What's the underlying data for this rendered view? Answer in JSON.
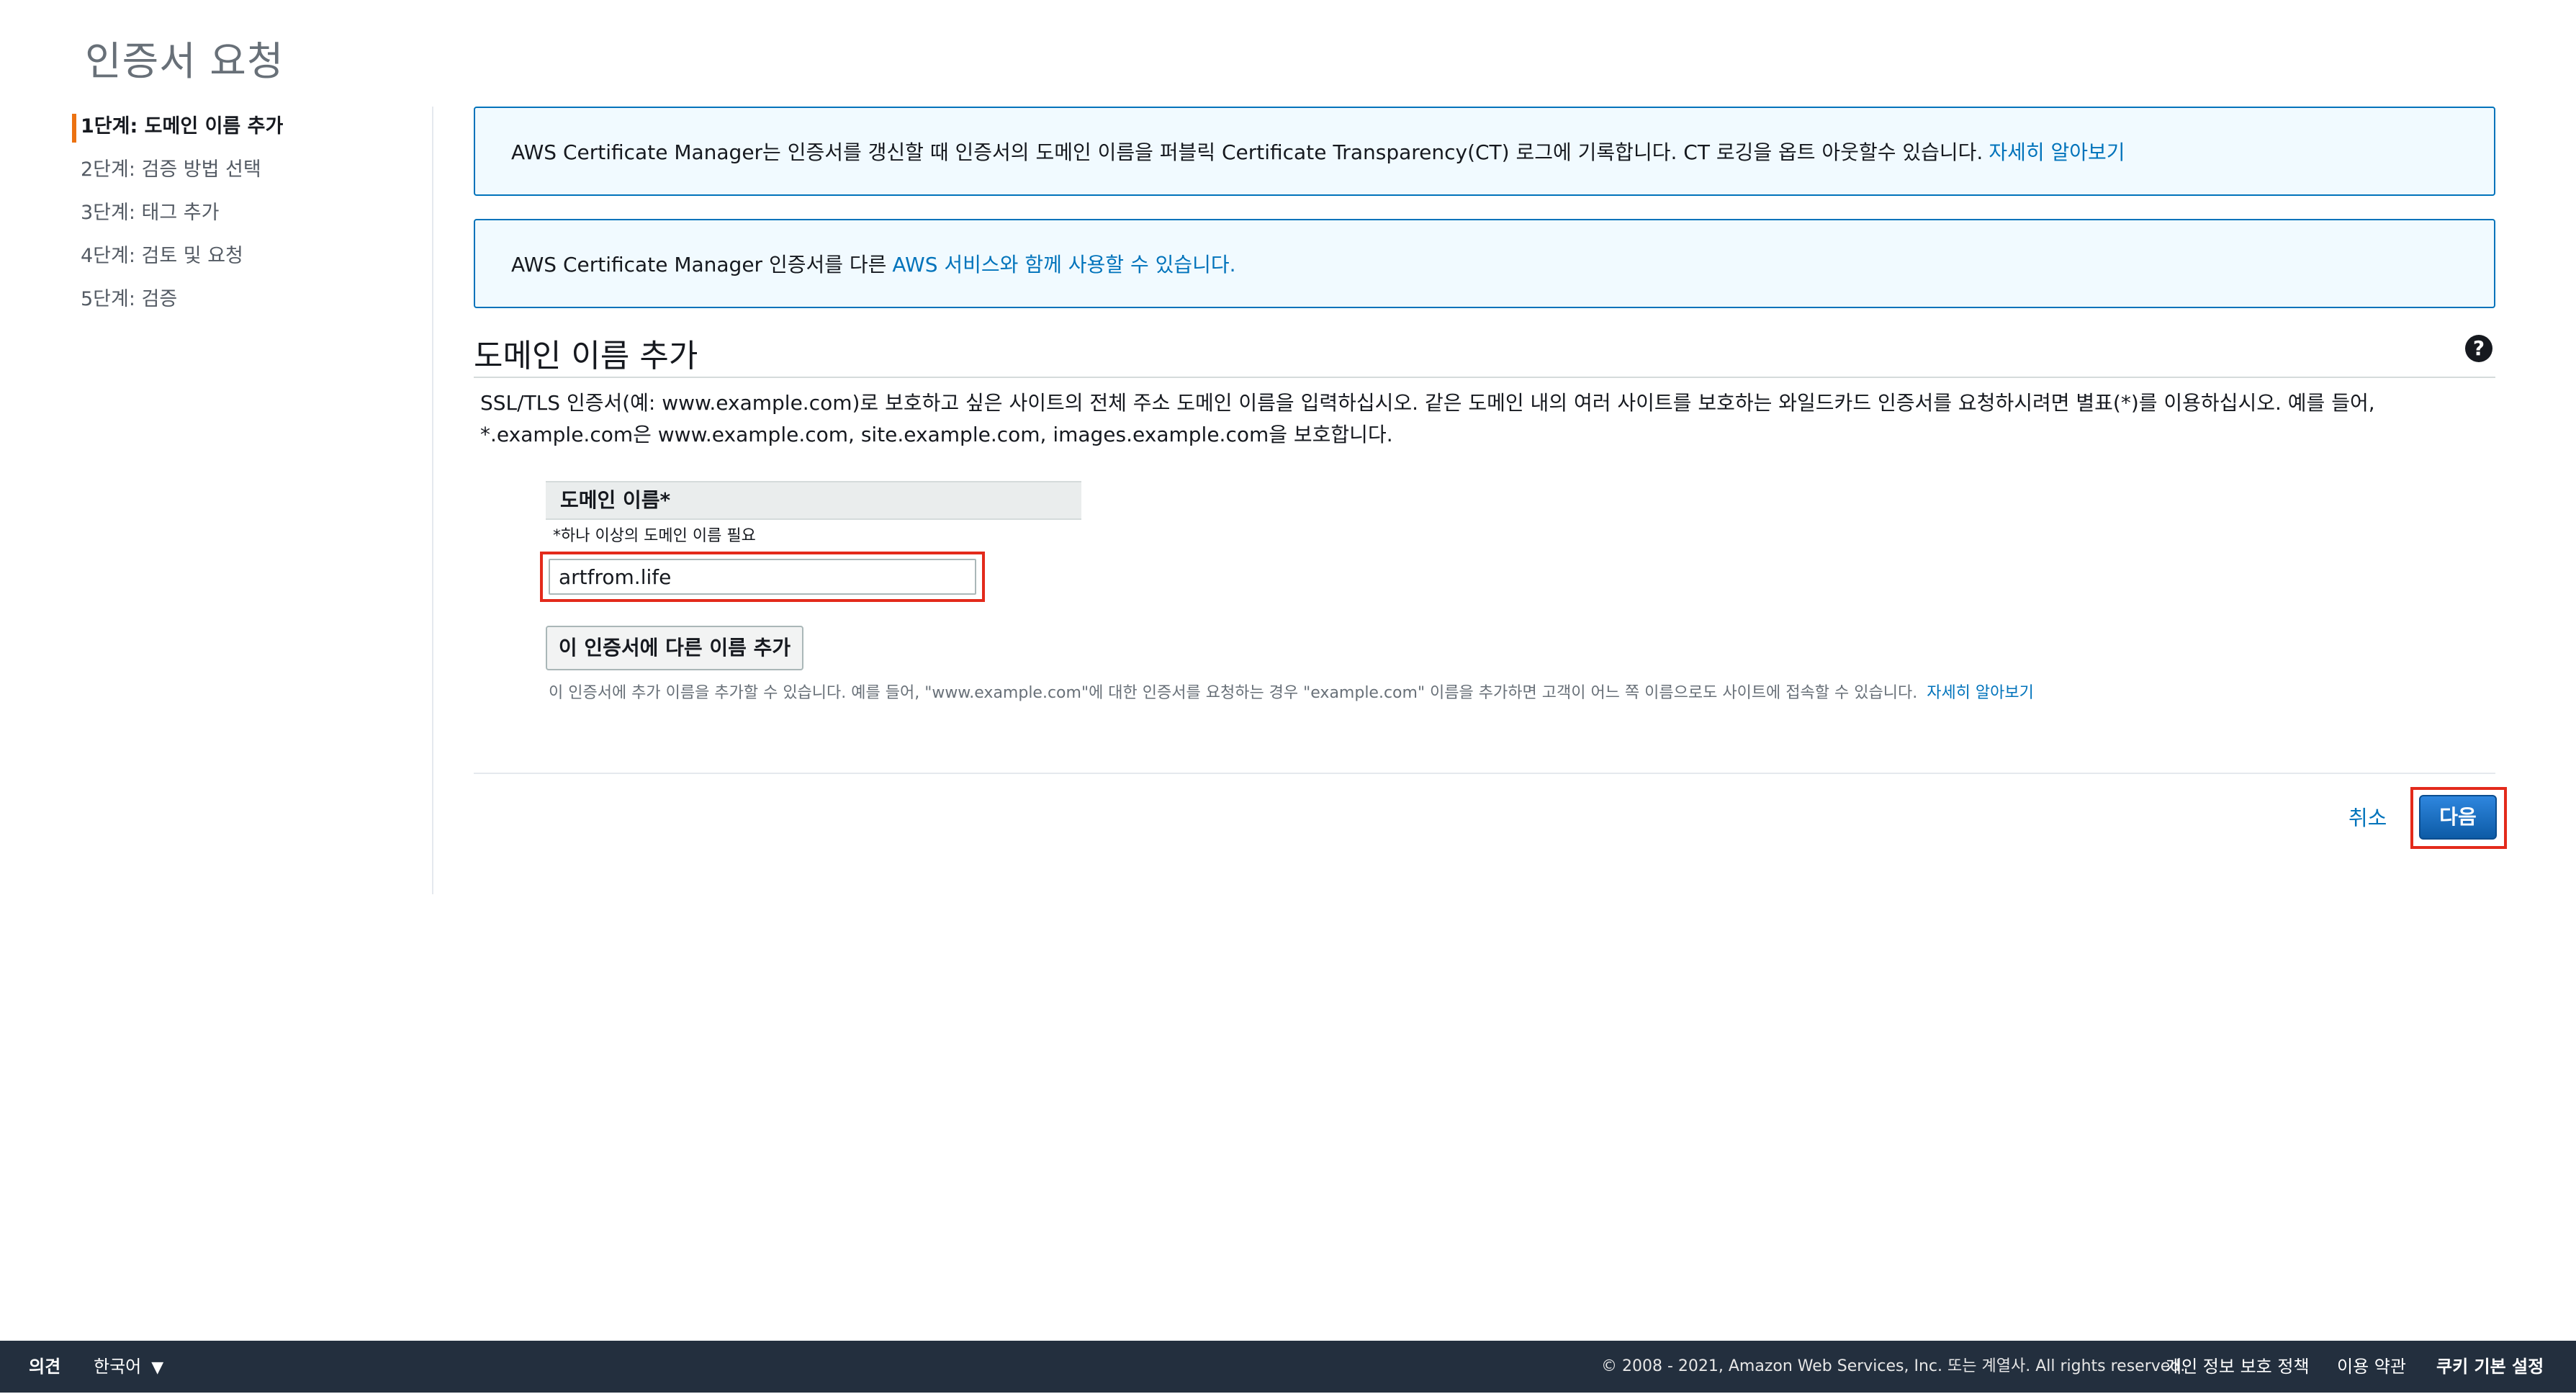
{
  "page": {
    "title": "인증서 요청"
  },
  "steps": [
    {
      "label": "1단계: 도메인 이름 추가"
    },
    {
      "label": "2단계: 검증 방법 선택"
    },
    {
      "label": "3단계: 태그 추가"
    },
    {
      "label": "4단계: 검토 및 요청"
    },
    {
      "label": "5단계: 검증"
    }
  ],
  "info": {
    "box1_text": "AWS Certificate Manager는 인증서를 갱신할 때 인증서의 도메인 이름을 퍼블릭 Certificate Transparency(CT) 로그에 기록합니다. CT 로깅을 옵트 아웃할수 있습니다.",
    "box1_link": "자세히 알아보기",
    "box2_text": "AWS Certificate Manager 인증서를 다른",
    "box2_link": "AWS 서비스와 함께 사용할 수 있습니다."
  },
  "section": {
    "title": "도메인 이름 추가",
    "description": "SSL/TLS 인증서(예: www.example.com)로 보호하고 싶은 사이트의 전체 주소 도메인 이름을 입력하십시오. 같은 도메인 내의 여러 사이트를 보호하는 와일드카드 인증서를 요청하시려면 별표(*)를 이용하십시오. 예를 들어, *.example.com은 www.example.com, site.example.com, images.example.com을 보호합니다."
  },
  "field": {
    "header": "도메인 이름*",
    "note": "*하나 이상의 도메인 이름 필요",
    "value": "artfrom.life"
  },
  "add_name": {
    "button": "이 인증서에 다른 이름 추가",
    "hint": "이 인증서에 추가 이름을 추가할 수 있습니다. 예를 들어, \"www.example.com\"에 대한 인증서를 요청하는 경우 \"example.com\" 이름을 추가하면 고객이 어느 쪽 이름으로도 사이트에 접속할 수 있습니다.",
    "hint_link": "자세히 알아보기"
  },
  "actions": {
    "cancel": "취소",
    "next": "다음"
  },
  "footer": {
    "feedback": "의견",
    "language": "한국어",
    "copyright": "© 2008 - 2021, Amazon Web Services, Inc. 또는 계열사. All rights reserved.",
    "privacy": "개인 정보 보호 정책",
    "terms": "이용 약관",
    "cookies": "쿠키 기본 설정"
  },
  "colors": {
    "accent": "#0073bb",
    "step_marker": "#ec7211",
    "highlight": "#e32a1b",
    "footer_bg": "#232f3e"
  }
}
